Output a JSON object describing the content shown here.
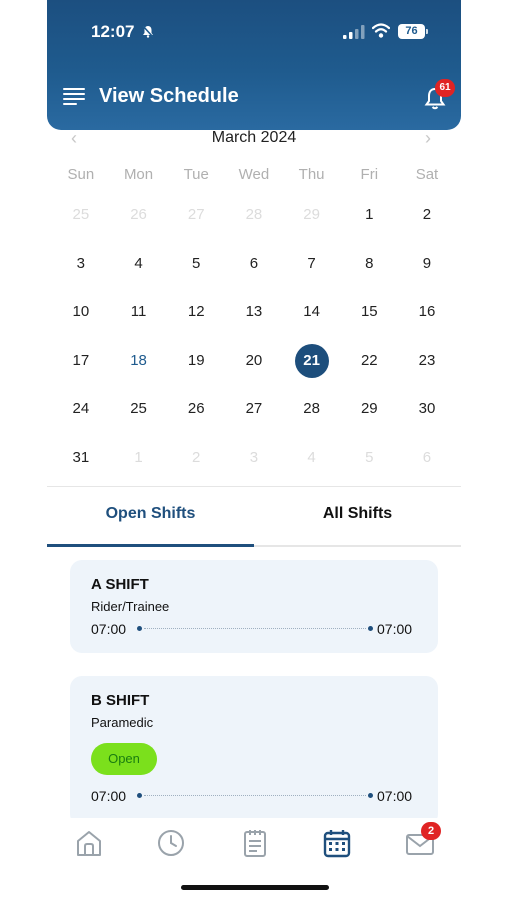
{
  "status_bar": {
    "time": "12:07",
    "battery": "76"
  },
  "header": {
    "title": "View Schedule",
    "notification_count": "61"
  },
  "calendar": {
    "month_label": "March 2024",
    "weekdays": [
      "Sun",
      "Mon",
      "Tue",
      "Wed",
      "Thu",
      "Fri",
      "Sat"
    ],
    "weeks": [
      [
        "25",
        "26",
        "27",
        "28",
        "29",
        "1",
        "2"
      ],
      [
        "3",
        "4",
        "5",
        "6",
        "7",
        "8",
        "9"
      ],
      [
        "10",
        "11",
        "12",
        "13",
        "14",
        "15",
        "16"
      ],
      [
        "17",
        "18",
        "19",
        "20",
        "21",
        "22",
        "23"
      ],
      [
        "24",
        "25",
        "26",
        "27",
        "28",
        "29",
        "30"
      ],
      [
        "31",
        "1",
        "2",
        "3",
        "4",
        "5",
        "6"
      ]
    ],
    "selected_day": "21",
    "today": "18"
  },
  "tabs": {
    "open": "Open Shifts",
    "all": "All Shifts"
  },
  "shifts": [
    {
      "name": "A SHIFT",
      "role": "Rider/Trainee",
      "start": "07:00",
      "end": "07:00"
    },
    {
      "name": "B SHIFT",
      "role": "Paramedic",
      "status": "Open",
      "start": "07:00",
      "end": "07:00"
    }
  ],
  "bottom_nav": {
    "mail_badge": "2"
  },
  "colors": {
    "primary": "#1f4f7d",
    "badge": "#e02424",
    "open_pill": "#7be01c",
    "card_bg": "#eef4fa"
  }
}
